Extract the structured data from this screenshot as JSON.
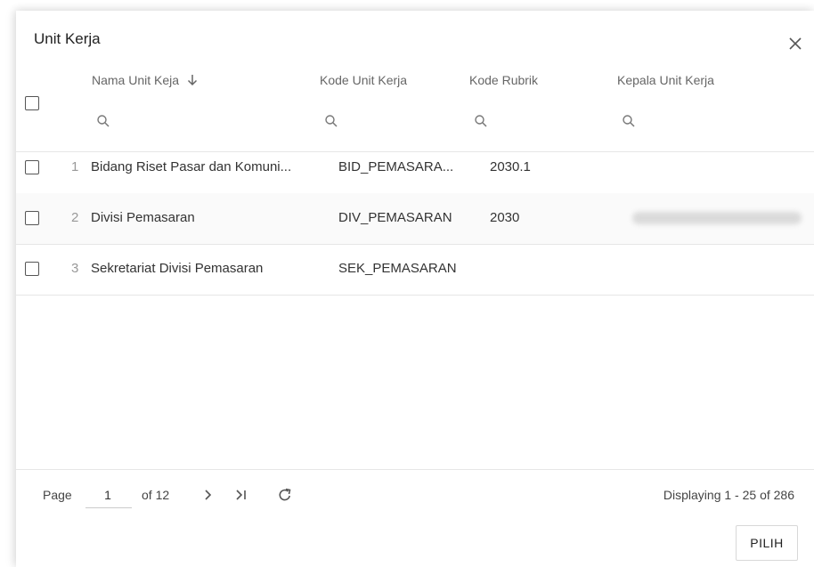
{
  "dialog": {
    "title": "Unit Kerja"
  },
  "columns": [
    {
      "title": "Nama Unit Keja",
      "sort": "descending"
    },
    {
      "title": "Kode Unit Kerja"
    },
    {
      "title": "Kode Rubrik"
    },
    {
      "title": "Kepala Unit Kerja"
    }
  ],
  "rows": [
    {
      "num": "1",
      "nama": "Bidang Riset Pasar dan Komuni...",
      "kode": "BID_PEMASARA...",
      "rubrik": "2030.1",
      "kepala": ""
    },
    {
      "num": "2",
      "nama": "Divisi Pemasaran",
      "kode": "DIV_PEMASARAN",
      "rubrik": "2030",
      "kepala": ""
    },
    {
      "num": "3",
      "nama": "Sekretariat Divisi Pemasaran",
      "kode": "SEK_PEMASARAN",
      "rubrik": "",
      "kepala": ""
    }
  ],
  "paging": {
    "page_label": "Page",
    "page_value": "1",
    "of_label": "of 12",
    "displaying": "Displaying 1 - 25 of 286"
  },
  "actions": {
    "pilih": "PILIH"
  },
  "icons": {
    "close": "close-icon",
    "sort": "arrow-down-icon",
    "search": "search-icon",
    "next": "chevron-right-icon",
    "last": "last-page-icon",
    "refresh": "refresh-icon"
  }
}
